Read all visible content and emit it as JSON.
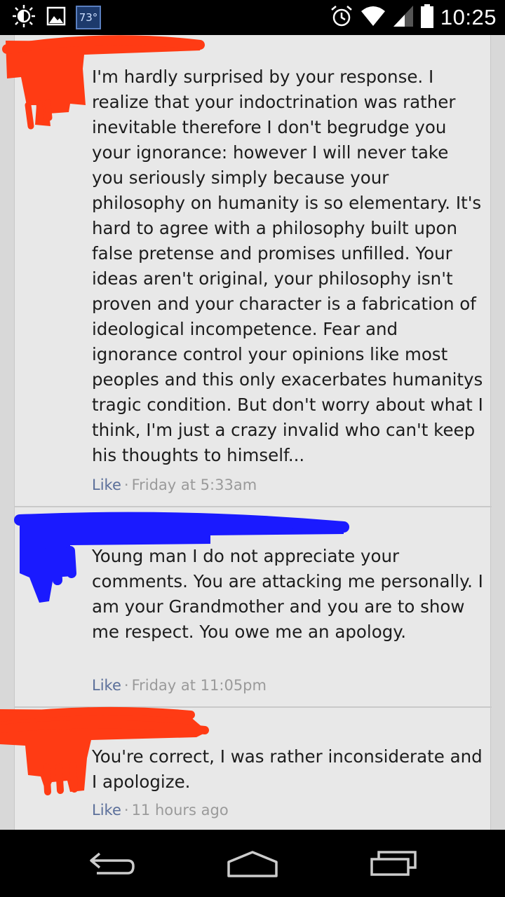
{
  "status_bar": {
    "temperature": "73°",
    "time": "10:25",
    "icons": [
      "brightness-icon",
      "image-icon",
      "weather-badge",
      "alarm-icon",
      "wifi-icon",
      "signal-icon",
      "battery-icon"
    ]
  },
  "comments": [
    {
      "author_redacted": true,
      "redaction_color": "#ff3b14",
      "text": "I'm hardly surprised by your response. I realize that your indoctrination was rather inevitable therefore I don't begrudge you your ignorance: however I will never take you seriously simply because your philosophy on humanity is so elementary. It's hard to agree with a philosophy built upon false pretense and promises unfilled. Your ideas aren't original, your philosophy isn't proven and your character is a fabrication of ideological incompetence. Fear and ignorance control your opinions like most peoples and this only exacerbates humanitys tragic condition. But don't worry about what I think, I'm just a crazy invalid who can't keep his thoughts to himself...",
      "like_label": "Like",
      "separator": "·",
      "timestamp": "Friday at 5:33am"
    },
    {
      "author_redacted": true,
      "redaction_color": "#1a1aff",
      "text": "Young man I do not appreciate your comments. You are attacking me personally. I am your Grandmother and you are to show me respect. You owe me an apology.",
      "like_label": "Like",
      "separator": "·",
      "timestamp": "Friday at 11:05pm"
    },
    {
      "author_redacted": true,
      "redaction_color": "#ff3b14",
      "text": "You're correct, I was rather inconsiderate and I apologize.",
      "like_label": "Like",
      "separator": "·",
      "timestamp": "11 hours ago"
    }
  ],
  "nav_bar": {
    "buttons": [
      "back-button",
      "home-button",
      "recent-apps-button"
    ]
  }
}
